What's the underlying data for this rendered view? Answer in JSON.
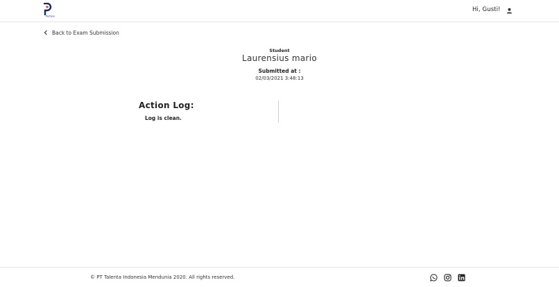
{
  "header": {
    "logo_name": "Pactlyxs",
    "greeting": "Hi, Gusti!",
    "user_icon": "person-icon"
  },
  "nav": {
    "back_label": "Back to Exam Submission",
    "back_icon": "chevron-left-icon"
  },
  "submission": {
    "student_label": "Student",
    "student_name": "Laurensius mario",
    "submitted_label": "Submitted at :",
    "submitted_at": "02/03/2021 3:48:13"
  },
  "log": {
    "title": "Action Log:",
    "status": "Log is clean."
  },
  "footer": {
    "copyright": "© PT Talenta Indonesia Mendunia 2020. All rights reserved.",
    "social": [
      "whatsapp-icon",
      "instagram-icon",
      "linkedin-icon"
    ]
  },
  "colors": {
    "brand_navy": "#1b2a5c",
    "brand_red": "#e03a3a",
    "border": "#e6e6e6"
  }
}
